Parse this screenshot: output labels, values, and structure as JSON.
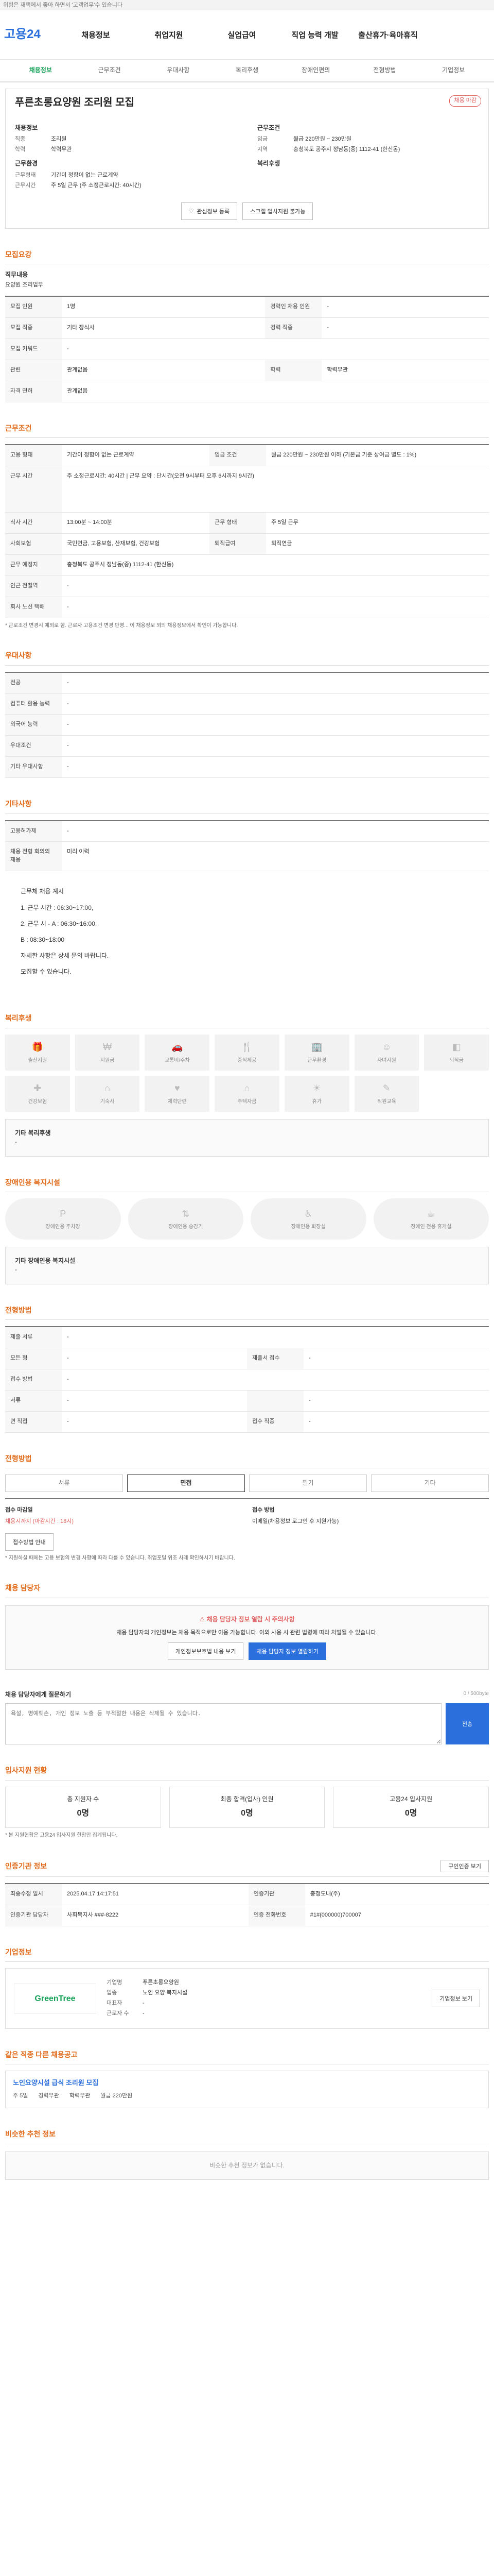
{
  "topbar": "위험은 재택에서 좋아 하면서 '고객업무'수 있습니다",
  "header": {
    "logo": "고용24",
    "gnb": [
      "채용정보",
      "취업지원",
      "실업급여",
      "직업 능력 개발",
      "출산휴가·육아휴직"
    ],
    "search_placeholder": "검색"
  },
  "subtabs": [
    "채용정보",
    "근무조건",
    "우대사항",
    "복리후생",
    "장애인편의",
    "전형방법",
    "기업정보"
  ],
  "job": {
    "flag": "채용 마감",
    "title": "푸른초롱요양원 조리원 모집",
    "left_head": "채용정보",
    "left_rows": [
      {
        "k": "직종",
        "v": "조리원"
      },
      {
        "k": "학력",
        "v": "학력무관"
      }
    ],
    "left_head2": "근무환경",
    "left_rows2": [
      {
        "k": "근무형태",
        "v": "기간이 정함이 없는 근로계약"
      },
      {
        "k": "근무시간",
        "v": "주 5일 근무 (주 소정근로시간: 40시간)"
      }
    ],
    "right_head": "근무조건",
    "right_rows": [
      {
        "k": "임금",
        "v": "월급 220만원 ~ 230만원"
      },
      {
        "k": "지역",
        "v": "충청북도 공주시 정남동(중) 1112-41 (한신동)"
      }
    ],
    "right_head2": "복리후생",
    "btn_interest": "관심정보 등록",
    "btn_apply": "스크랩 입사지원 불가능"
  },
  "recruit": {
    "title": "모집요강",
    "sub": "직무내용",
    "sub_v": "요양원 조리업무",
    "rows": [
      [
        "모집 인원",
        "1명",
        "경력인 채용 인원",
        "-"
      ],
      [
        "모집 직종",
        "기타 장식사",
        "경력 직종",
        "-"
      ],
      [
        "모집 키워드",
        "-",
        "",
        ""
      ],
      [
        "관련",
        "관계없음",
        "학력",
        "학력무관"
      ],
      [
        "자격 면허",
        "관계없음",
        "",
        ""
      ]
    ]
  },
  "conditions": {
    "title": "근무조건",
    "rows": [
      [
        "고용 형태",
        "기간이 정함이 없는 근로계약",
        "임금 조건",
        "월급 220만원 ~ 230만원 이하 (기본급 기준 상여금 별도 : 1%)"
      ],
      [
        "근무 시간",
        "주 소정근로시간: 40시간 | 근무 요약 : 단시간(오전 9시부터 오후 6시까지 9시간)",
        "",
        ""
      ],
      [
        "식사 시간",
        "13:00분 ~ 14:00분",
        "근무 형태",
        "주 5일 근무"
      ],
      [
        "사회보험",
        "국민연금, 고용보험, 산재보험, 건강보험",
        "퇴직급여",
        "퇴직연금"
      ],
      [
        "근무 예정지",
        "충청북도 공주시 정남동(중) 1112-41 (한신동)",
        "",
        ""
      ],
      [
        "인근 전철역",
        "-",
        "",
        ""
      ],
      [
        "회사 노선 택배",
        "-",
        "",
        ""
      ]
    ],
    "note": "* 근로조건 변경시 예외로 함. 근로자 고용조건 변경 반영... 이 채용정보 외의 채용정보에서 확인이 가능합니다."
  },
  "preferred": {
    "title": "우대사항",
    "rows": [
      [
        "전공",
        "-"
      ],
      [
        "컴퓨터 활용 능력",
        "-"
      ],
      [
        "외국어 능력",
        "-"
      ],
      [
        "우대조건",
        "-"
      ],
      [
        "기타 우대사항",
        "-"
      ]
    ]
  },
  "other": {
    "title": "기타사항",
    "rows": [
      [
        "고용허가제",
        "-"
      ],
      [
        "채용 전형 회의의 재용",
        "미리 이력"
      ]
    ],
    "body": [
      "근무체 채용 계시",
      "1. 근무 시간 : 06:30~17:00,",
      "2. 근무 시 - A : 06:30~16:00,",
      "B : 08:30~18:00",
      "자세한 사항은 상세 문의 바랍니다.",
      "모집할 수 있습니다."
    ]
  },
  "welfare": {
    "title": "복리후생",
    "items": [
      "출산지원",
      "지원금",
      "교통비/주차",
      "중식제공",
      "근무환경",
      "자녀지원",
      "퇴직금",
      "건강보험",
      "기숙사",
      "체력단련",
      "주택자금",
      "휴가",
      "직원교육"
    ],
    "other_title": "기타 복리후생",
    "other_v": "-"
  },
  "facility": {
    "title": "장애인용 복지시설",
    "items": [
      "장애인용 주차장",
      "장애인용 승강기",
      "장애인용 화장실",
      "장애인 전용 휴게실"
    ],
    "other_title": "기타 장애인용 복지시설",
    "other_v": "-"
  },
  "process": {
    "title": "전형방법",
    "rows": [
      [
        "제출 서류",
        "-",
        ""
      ],
      [
        "모든 형",
        "-",
        "제출서 접수",
        "-"
      ],
      [
        "접수 방법",
        "-",
        ""
      ],
      [
        "서류",
        "-",
        "",
        "-"
      ],
      [
        "면 직접",
        "-",
        "접수 직종",
        "-"
      ]
    ]
  },
  "apply": {
    "title": "전형방법",
    "tabs": [
      "서류",
      "면접",
      "필기",
      "기타"
    ],
    "period_k": "접수 마감일",
    "period_v": "채용시까지 (마감시간 : 18시)",
    "method_k": "접수 방법",
    "method_v": "이메일(채용정보 로그인 후 지원가능)",
    "btn": "접수방법 안내",
    "note": "* 지원하실 때에는 고용 보험의 변경 사항에 따라 다를 수 있습니다. 취업포털 위조 사례 확인하시기 바랍니다."
  },
  "manager": {
    "title": "채용 담당자",
    "box_title": "채용 담당자 정보 열람 시 주의사항",
    "box_text": "채용 담당자의 개인정보는 채용 목적으로만 이용 가능합니다. 이외 사용 시 관련 법령에 따라 처벌될 수 있습니다.",
    "btn1": "개인정보보호법 내용 보기",
    "btn2": "채용 담당자 정보 열람하기"
  },
  "ask": {
    "title": "채용 담당자에게 질문하기",
    "count": "0 / 500byte",
    "placeholder": "욕설, 명예훼손, 개인 정보 노출 등 부적절한 내용은 삭제될 수 있습니다.",
    "btn": "전송"
  },
  "status": {
    "title": "입사지원 현황",
    "items": [
      [
        "총 지원자 수",
        "0명"
      ],
      [
        "최종 합격(입사) 인원",
        "0명"
      ],
      [
        "고용24 입사지원",
        "0명"
      ]
    ],
    "note": "* 본 지원현황은 고용24 입사지원 현황만 집계됩니다."
  },
  "reg": {
    "title": "인증기관 정보",
    "btn": "구인인증 보기",
    "rows": [
      [
        "최종수정 일시",
        "2025.04.17 14:17:51",
        "인증기관",
        "충청도내(주)"
      ],
      [
        "인증기관 담당자",
        "사회복지사 ###-8222",
        "인증 전화번호",
        "#1#(000000)700007"
      ]
    ]
  },
  "company": {
    "title": "기업정보",
    "logo": "GreenTree",
    "rows": [
      [
        "기업명",
        "푸른초롱요양원"
      ],
      [
        "업종",
        "노인 요양 복지시설"
      ],
      [
        "대표자",
        "-"
      ],
      [
        "근로자 수",
        "-"
      ]
    ],
    "btn": "기업정보 보기"
  },
  "similar": {
    "title": "같은 직종 다른 채용공고",
    "item_title": "노인요양시설 급식 조리원 모집",
    "item_rows": [
      "주 5일",
      "경력무관",
      "학력무관",
      "월급 220만원"
    ]
  },
  "recommend": {
    "title": "비슷한 추천 정보",
    "empty": "비슷한 추천 정보가 없습니다."
  }
}
